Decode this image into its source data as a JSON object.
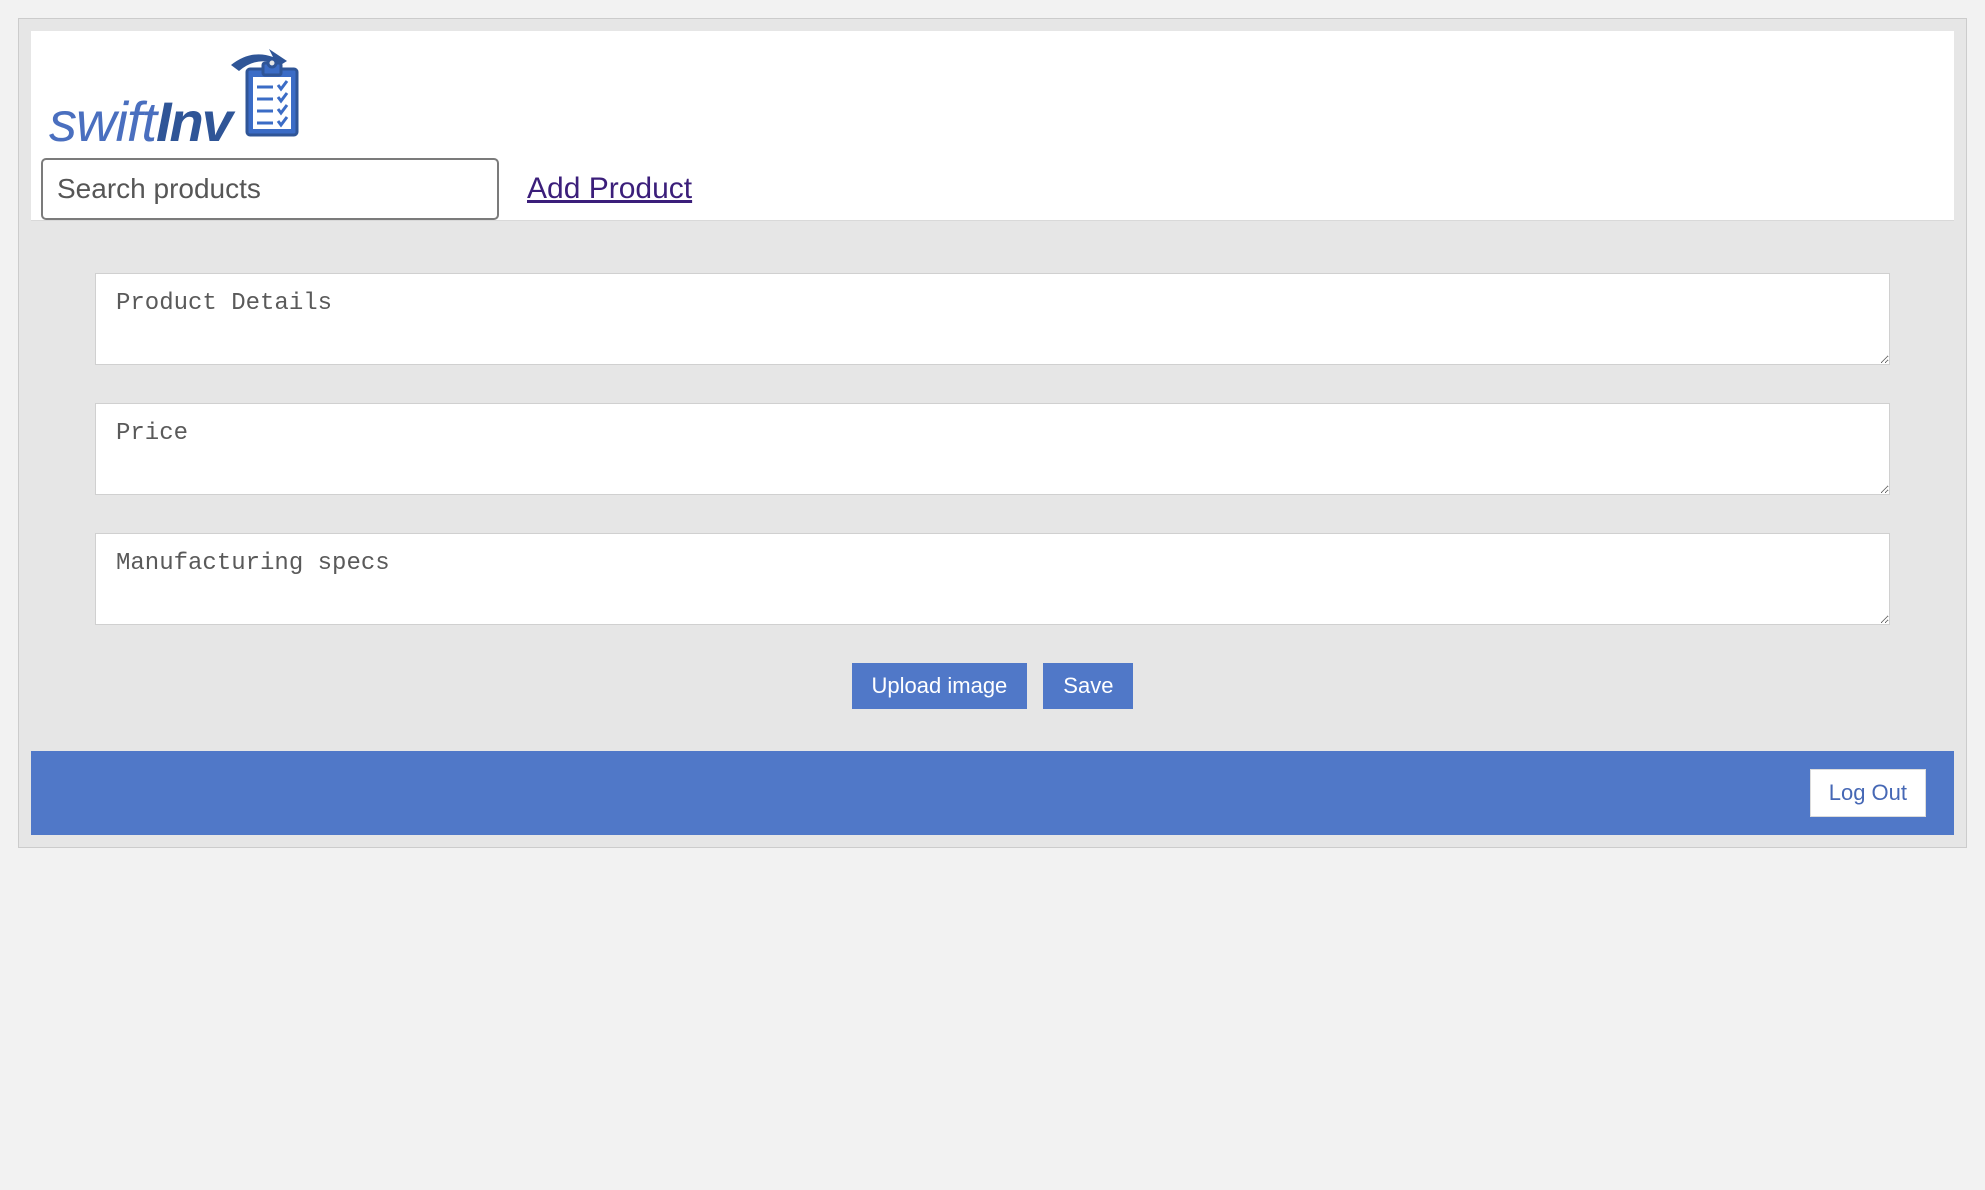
{
  "logo": {
    "text_swift": "swift",
    "text_inv": "Inv",
    "icon_name": "clipboard-checklist-icon"
  },
  "header": {
    "search_placeholder": "Search products",
    "search_value": "",
    "add_product_label": "Add Product"
  },
  "form": {
    "details_placeholder": "Product Details",
    "details_value": "",
    "price_placeholder": "Price",
    "price_value": "",
    "specs_placeholder": "Manufacturing specs",
    "specs_value": ""
  },
  "buttons": {
    "upload_image_label": "Upload image",
    "save_label": "Save",
    "logout_label": "Log Out"
  },
  "colors": {
    "accent": "#5078c8",
    "logo_light": "#4a6fbf",
    "logo_dark": "#2f5597",
    "link": "#3b1e7a"
  }
}
